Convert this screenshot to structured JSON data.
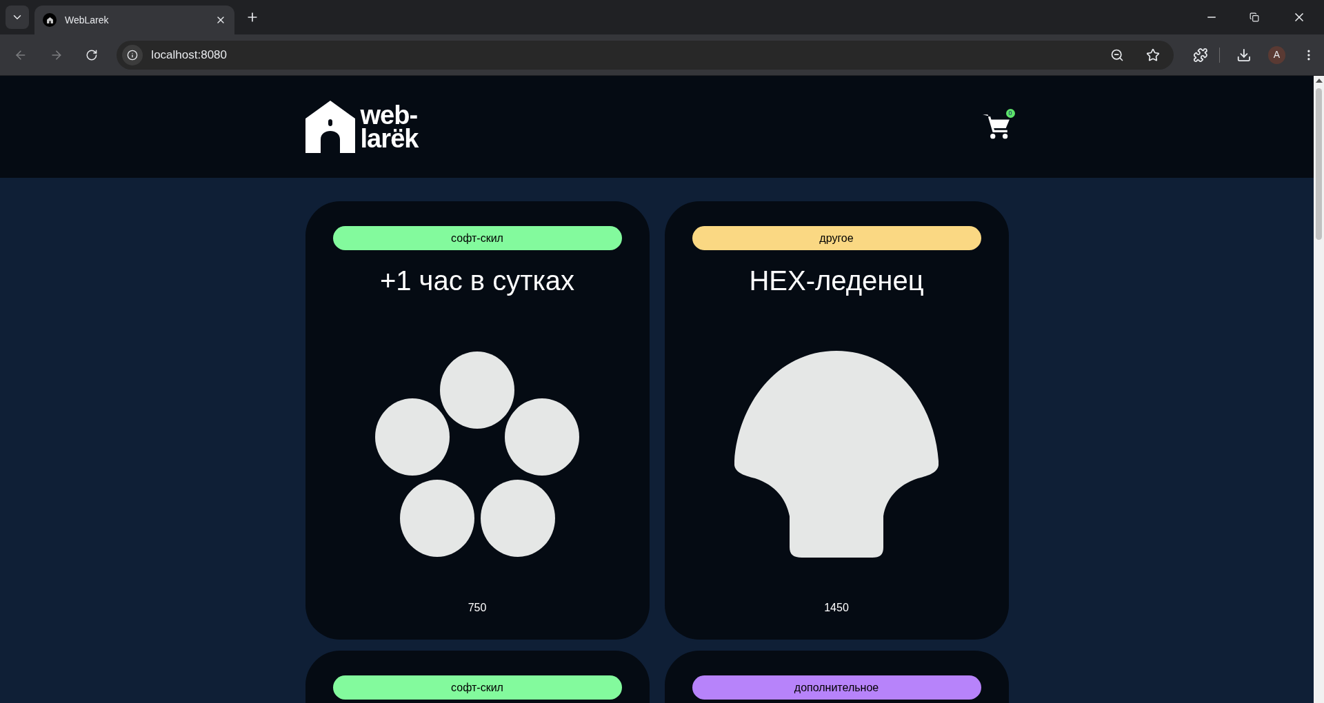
{
  "browser": {
    "tab_title": "WebLarek",
    "url": "localhost:8080",
    "profile_initial": "A"
  },
  "header": {
    "logo_lines": [
      "web-",
      "larёk"
    ],
    "cart_count": "0"
  },
  "cards": [
    {
      "category": "софт-скил",
      "color": "#83fa9d",
      "title": "+1 час в сутках",
      "kind": "circles",
      "price": "750"
    },
    {
      "category": "другое",
      "color": "#fad883",
      "title": "HEX-леденец",
      "kind": "mushroom",
      "price": "1450"
    },
    {
      "category": "софт-скил",
      "color": "#83fa9d"
    },
    {
      "category": "дополнительное",
      "color": "#b783fa"
    }
  ]
}
